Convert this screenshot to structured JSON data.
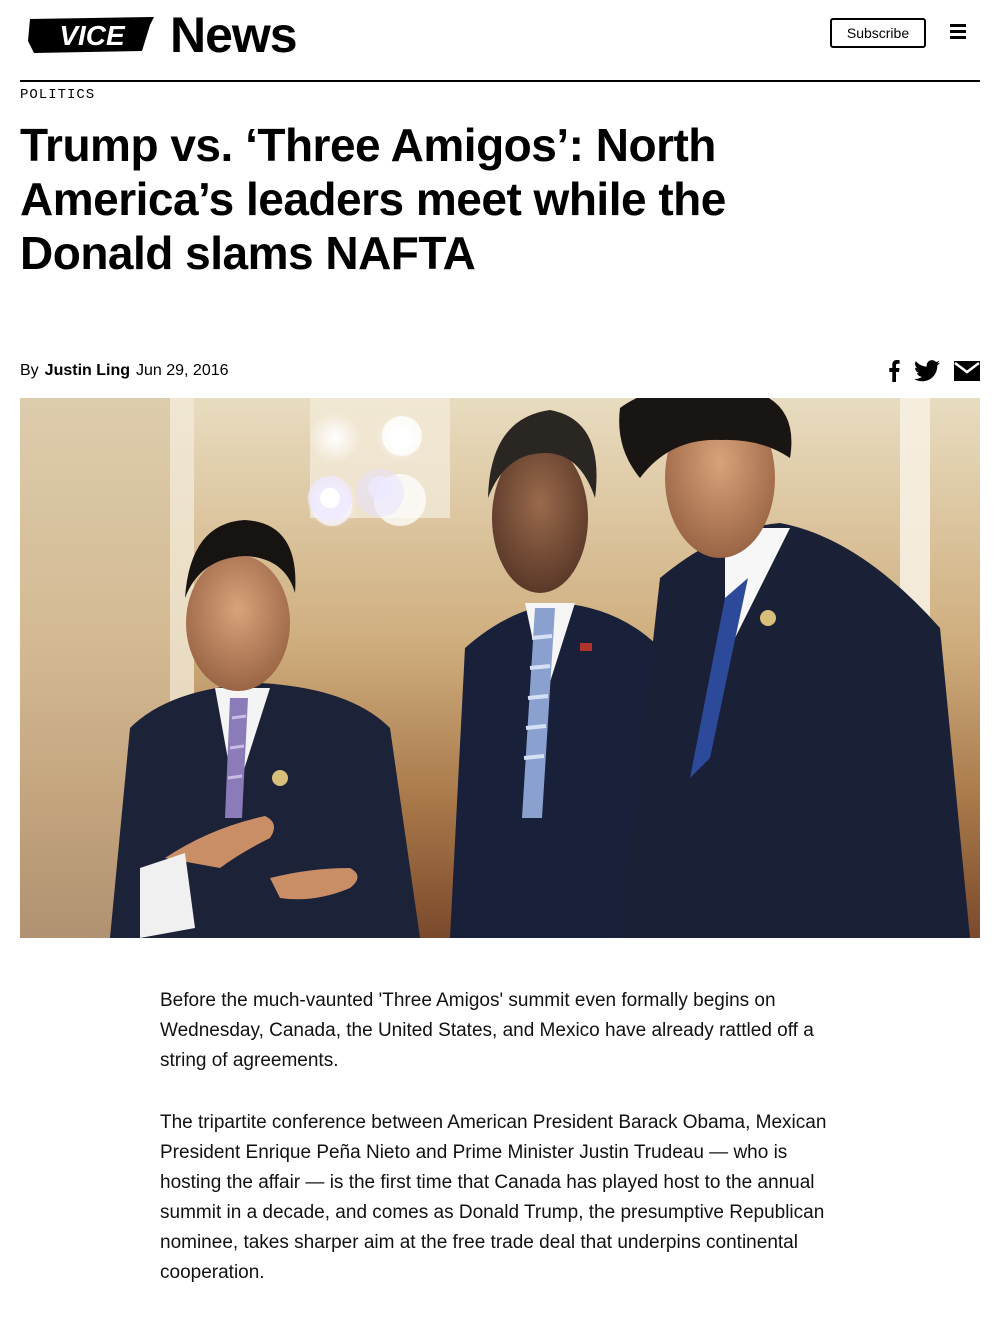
{
  "header": {
    "logo_brand": "VICE",
    "logo_section": "News",
    "subscribe_label": "Subscribe",
    "menu_icon": "hamburger-menu-icon"
  },
  "article": {
    "section": "POLITICS",
    "headline": "Trump vs. ‘Three Amigos’: North America’s leaders meet while the Donald slams NAFTA",
    "byline_prefix": "By",
    "author": "Justin Ling",
    "date": "Jun 29, 2016",
    "share_icons": [
      "facebook-icon",
      "twitter-icon",
      "email-icon"
    ],
    "hero_image": "photo-three-leaders-in-dark-suits",
    "paragraphs": [
      "Before the much-vaunted 'Three Amigos' summit even formally begins on Wednesday, Canada, the United States, and Mexico have already rattled off a string of agreements.",
      "The tripartite conference between American President Barack Obama, Mexican President Enrique Peña Nieto and Prime Minister Justin Trudeau — who is hosting the affair — is the first time that Canada has played host to the annual summit in a decade, and comes as Donald Trump, the presumptive Republican nominee, takes sharper aim at the free trade deal that underpins continental cooperation."
    ]
  }
}
